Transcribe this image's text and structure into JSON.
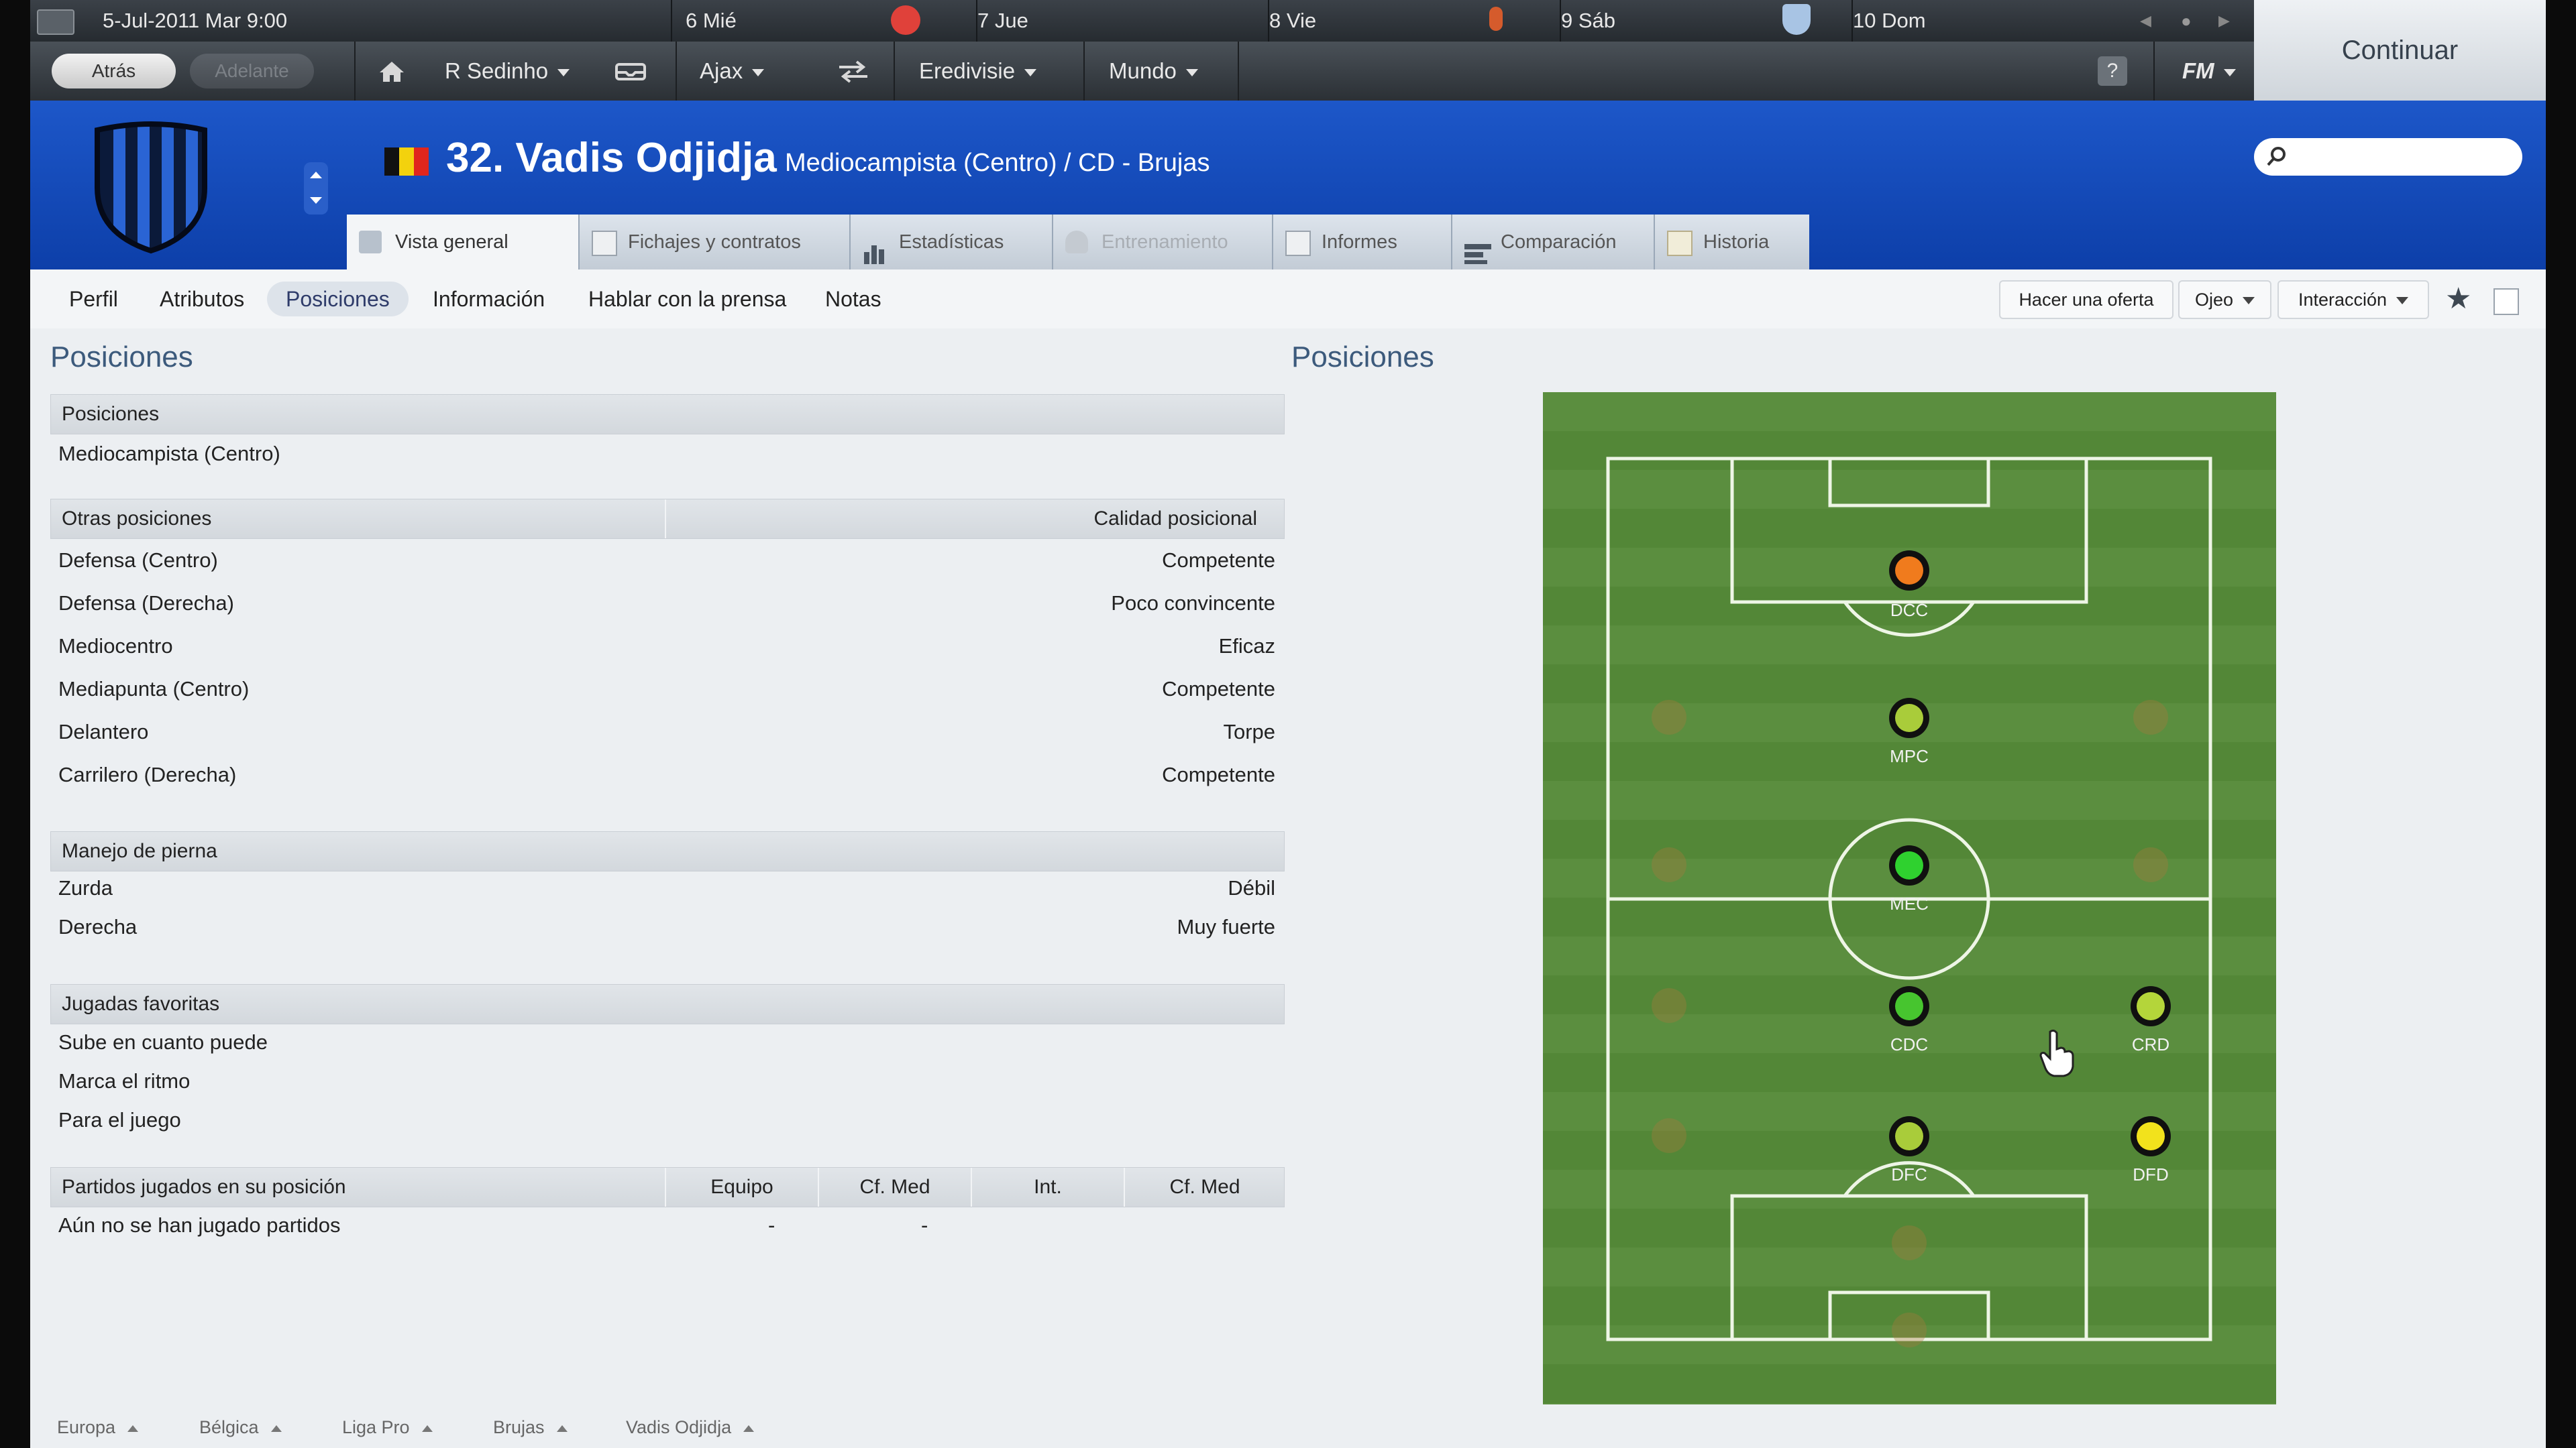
{
  "calendar": {
    "date": "5-Jul-2011 Mar 9:00",
    "days": [
      "6 Mié",
      "7 Jue",
      "8 Vie",
      "9 Sáb",
      "10 Dom"
    ]
  },
  "continue_label": "Continuar",
  "nav": {
    "back": "Atrás",
    "forward": "Adelante",
    "manager": "R Sedinho",
    "club": "Ajax",
    "league": "Eredivisie",
    "world": "Mundo",
    "help": "?",
    "fm_menu": "FM"
  },
  "player": {
    "title": "32. Vadis Odjidja",
    "subtitle": "Mediocampista (Centro) / CD - Brujas"
  },
  "tabs": [
    "Vista general",
    "Fichajes y contratos",
    "Estadísticas",
    "Entrenamiento",
    "Informes",
    "Comparación",
    "Historia"
  ],
  "subnav": [
    "Perfil",
    "Atributos",
    "Posiciones",
    "Información",
    "Hablar con la prensa",
    "Notas"
  ],
  "actions": {
    "offer": "Hacer una oferta",
    "scout": "Ojeo",
    "interaction": "Interacción"
  },
  "left_title": "Posiciones",
  "right_title": "Posiciones",
  "positions": {
    "header": "Posiciones",
    "main": "Mediocampista (Centro)"
  },
  "other_positions": {
    "header": "Otras posiciones",
    "quality_header": "Calidad posicional",
    "rows": [
      {
        "name": "Defensa (Centro)",
        "quality": "Competente"
      },
      {
        "name": "Defensa (Derecha)",
        "quality": "Poco convincente"
      },
      {
        "name": "Mediocentro",
        "quality": "Eficaz"
      },
      {
        "name": "Mediapunta (Centro)",
        "quality": "Competente"
      },
      {
        "name": "Delantero",
        "quality": "Torpe"
      },
      {
        "name": "Carrilero (Derecha)",
        "quality": "Competente"
      }
    ]
  },
  "footedness": {
    "header": "Manejo de pierna",
    "rows": [
      {
        "name": "Zurda",
        "value": "Débil"
      },
      {
        "name": "Derecha",
        "value": "Muy fuerte"
      }
    ]
  },
  "moves": {
    "header": "Jugadas favoritas",
    "rows": [
      "Sube en cuanto puede",
      "Marca el ritmo",
      "Para el juego"
    ]
  },
  "matches": {
    "header": "Partidos jugados en su posición",
    "cols": [
      "Equipo",
      "Cf. Med",
      "Int.",
      "Cf. Med"
    ],
    "empty": "Aún no se han jugado partidos",
    "values": [
      "-",
      "-"
    ]
  },
  "pitch_positions": [
    {
      "label": "DCC",
      "color": "#f07b1d"
    },
    {
      "label": "MPC",
      "color": "#a9cc3a"
    },
    {
      "label": "MEC",
      "color": "#2fd12f"
    },
    {
      "label": "CDC",
      "color": "#47c52f"
    },
    {
      "label": "CRD",
      "color": "#b4d53a"
    },
    {
      "label": "DFC",
      "color": "#a9cc3a"
    },
    {
      "label": "DFD",
      "color": "#f2e21c"
    }
  ],
  "breadcrumbs": [
    "Europa",
    "Bélgica",
    "Liga Pro",
    "Brujas",
    "Vadis Odjidja"
  ]
}
